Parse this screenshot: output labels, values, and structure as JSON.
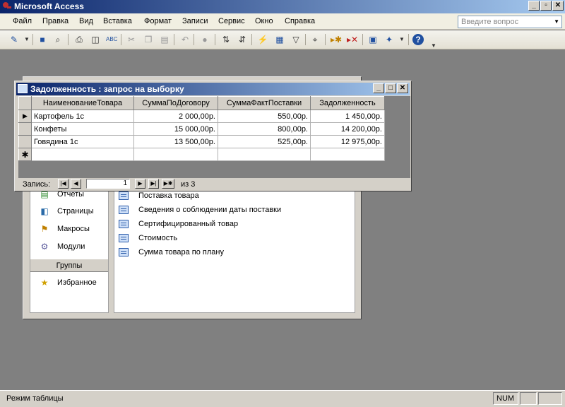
{
  "app": {
    "title": "Microsoft Access"
  },
  "menu": [
    "Файл",
    "Правка",
    "Вид",
    "Вставка",
    "Формат",
    "Записи",
    "Сервис",
    "Окно",
    "Справка"
  ],
  "ask": {
    "placeholder": "Введите вопрос"
  },
  "toolbar_icons": [
    "design-view-icon",
    "save-icon",
    "search-file-icon",
    "print-icon",
    "print-preview-icon",
    "spelling-icon",
    "cut-icon",
    "copy-icon",
    "paste-icon",
    "undo-icon",
    "hyperlink-icon",
    "sort-ascending-icon",
    "sort-descending-icon",
    "filter-by-selection-icon",
    "filter-by-form-icon",
    "apply-filter-icon",
    "find-icon",
    "new-record-icon",
    "delete-record-icon",
    "database-window-icon",
    "new-object-icon",
    "help-icon"
  ],
  "db_window": {
    "objects": [
      "Отчеты",
      "Страницы",
      "Макросы",
      "Модули"
    ],
    "groups_label": "Группы",
    "favorites": "Избранное",
    "queries": [
      "Поставка товара",
      "Сведения о соблюдении даты поставки",
      "Сертифицированный товар",
      "Стоимость",
      "Сумма товара по плану"
    ]
  },
  "query_window": {
    "title": "Задолженность : запрос на выборку",
    "columns": [
      "НаименованиеТовара",
      "СуммаПоДоговору",
      "СуммаФактПоставки",
      "Задолженность"
    ],
    "rows": [
      [
        "Картофель 1с",
        "2 000,00р.",
        "550,00р.",
        "1 450,00р."
      ],
      [
        "Конфеты",
        "15 000,00р.",
        "800,00р.",
        "14 200,00р."
      ],
      [
        "Говядина 1с",
        "13 500,00р.",
        "525,00р.",
        "12 975,00р."
      ]
    ],
    "nav": {
      "label": "Запись:",
      "current": "1",
      "of_label": "из  3"
    }
  },
  "status": {
    "text": "Режим таблицы",
    "num": "NUM"
  }
}
